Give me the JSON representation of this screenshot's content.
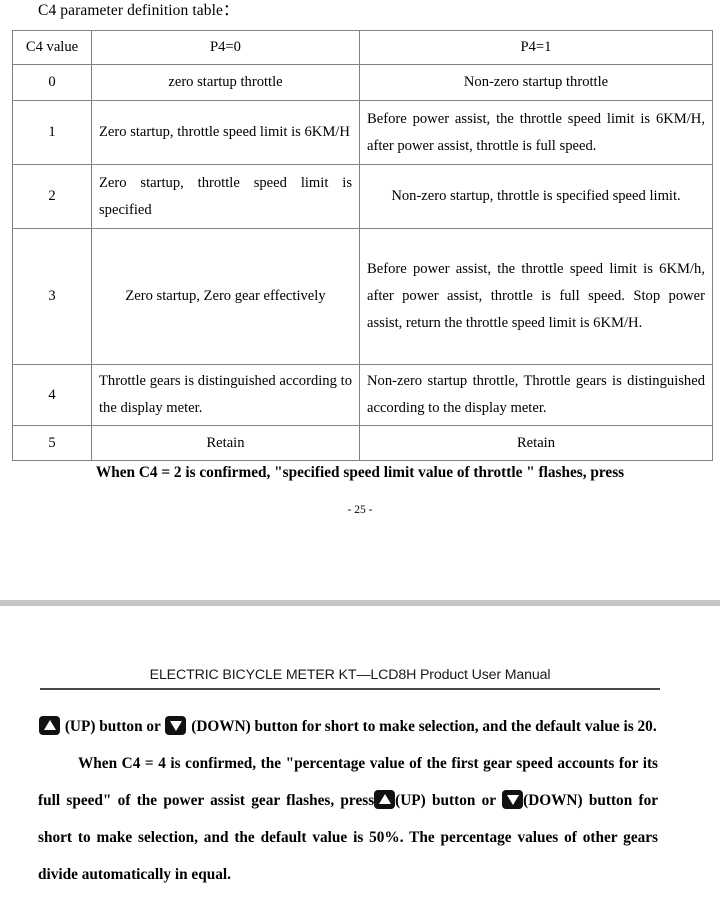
{
  "page_one": {
    "caption": "C4 parameter definition table：",
    "table": {
      "headers": [
        "C4 value",
        "P4=0",
        "P4=1"
      ],
      "rows": [
        {
          "value": "0",
          "p4_0": "zero startup throttle",
          "p4_1": "Non-zero startup throttle"
        },
        {
          "value": "1",
          "p4_0": "Zero startup, throttle speed limit is 6KM/H",
          "p4_1": "Before power assist, the throttle speed limit is 6KM/H, after power assist, throttle is full speed."
        },
        {
          "value": "2",
          "p4_0": "Zero startup, throttle speed limit is specified",
          "p4_1": "Non-zero startup, throttle is specified speed limit."
        },
        {
          "value": "3",
          "p4_0": "Zero startup, Zero gear effectively",
          "p4_1": "Before power assist, the throttle speed limit is 6KM/h, after power assist, throttle is full speed. Stop power assist,  return the throttle speed limit is 6KM/H."
        },
        {
          "value": "4",
          "p4_0": "Throttle gears is distinguished according to the display meter.",
          "p4_1": "Non-zero startup throttle, Throttle gears is distinguished according to the display meter."
        },
        {
          "value": "5",
          "p4_0": "Retain",
          "p4_1": "Retain"
        }
      ]
    },
    "note": "When C4 = 2 is confirmed, \"specified speed limit value of throttle \" flashes, press",
    "page_number": "- 25 -"
  },
  "page_two": {
    "running_head": "ELECTRIC BICYCLE METER KT—LCD8H Product User Manual",
    "paragraph_1": {
      "before_up": "",
      "after_up": "(UP) button or",
      "after_down": "(DOWN) button for short to make selection, and the default value is 20."
    },
    "paragraph_2": {
      "lead": "When C4 = 4 is confirmed, the \"percentage value of the first gear speed accounts for its full speed\" of the power assist gear flashes, press",
      "after_up": "(UP) button or",
      "after_down": "(DOWN) button for short to make selection, and the default value is 50%. The percentage values of other gears divide automatically in equal."
    }
  },
  "icons": {
    "up": "up-triangle-key-icon",
    "down": "down-triangle-key-icon"
  },
  "colors": {
    "text": "#000000",
    "table_border": "#808080",
    "page_gap_bar": "#c6c6c6",
    "head_rule": "#4a4a4a",
    "key_icon": "#111111"
  }
}
